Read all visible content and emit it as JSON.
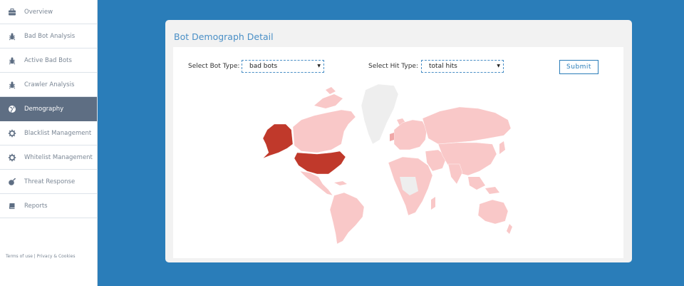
{
  "sidebar": {
    "items": [
      {
        "label": "Overview",
        "icon": "briefcase-icon",
        "active": false
      },
      {
        "label": "Bad Bot Analysis",
        "icon": "bug-icon",
        "active": false
      },
      {
        "label": "Active Bad Bots",
        "icon": "bug-icon",
        "active": false
      },
      {
        "label": "Crawler Analysis",
        "icon": "bug-icon",
        "active": false
      },
      {
        "label": "Demography",
        "icon": "globe-icon",
        "active": true
      },
      {
        "label": "Blacklist Management",
        "icon": "gear-icon",
        "active": false
      },
      {
        "label": "Whitelist Management",
        "icon": "gear-icon",
        "active": false
      },
      {
        "label": "Threat Response",
        "icon": "bomb-icon",
        "active": false
      },
      {
        "label": "Reports",
        "icon": "book-icon",
        "active": false
      }
    ],
    "footer": {
      "terms": "Terms of use",
      "separator": " | ",
      "privacy": "Privacy & Cookies"
    }
  },
  "panel": {
    "title": "Bot Demograph Detail",
    "bot_type": {
      "label": "Select Bot Type:",
      "value": "bad bots"
    },
    "hit_type": {
      "label": "Select Hit Type:",
      "value": "total hits"
    },
    "submit_label": "Submit"
  },
  "map": {
    "colors": {
      "high": "#c0392b",
      "low": "#f9c8c8",
      "none": "#eeeeee",
      "background": "#ffffff"
    },
    "highlighted_regions": [
      "United States",
      "Alaska"
    ]
  }
}
